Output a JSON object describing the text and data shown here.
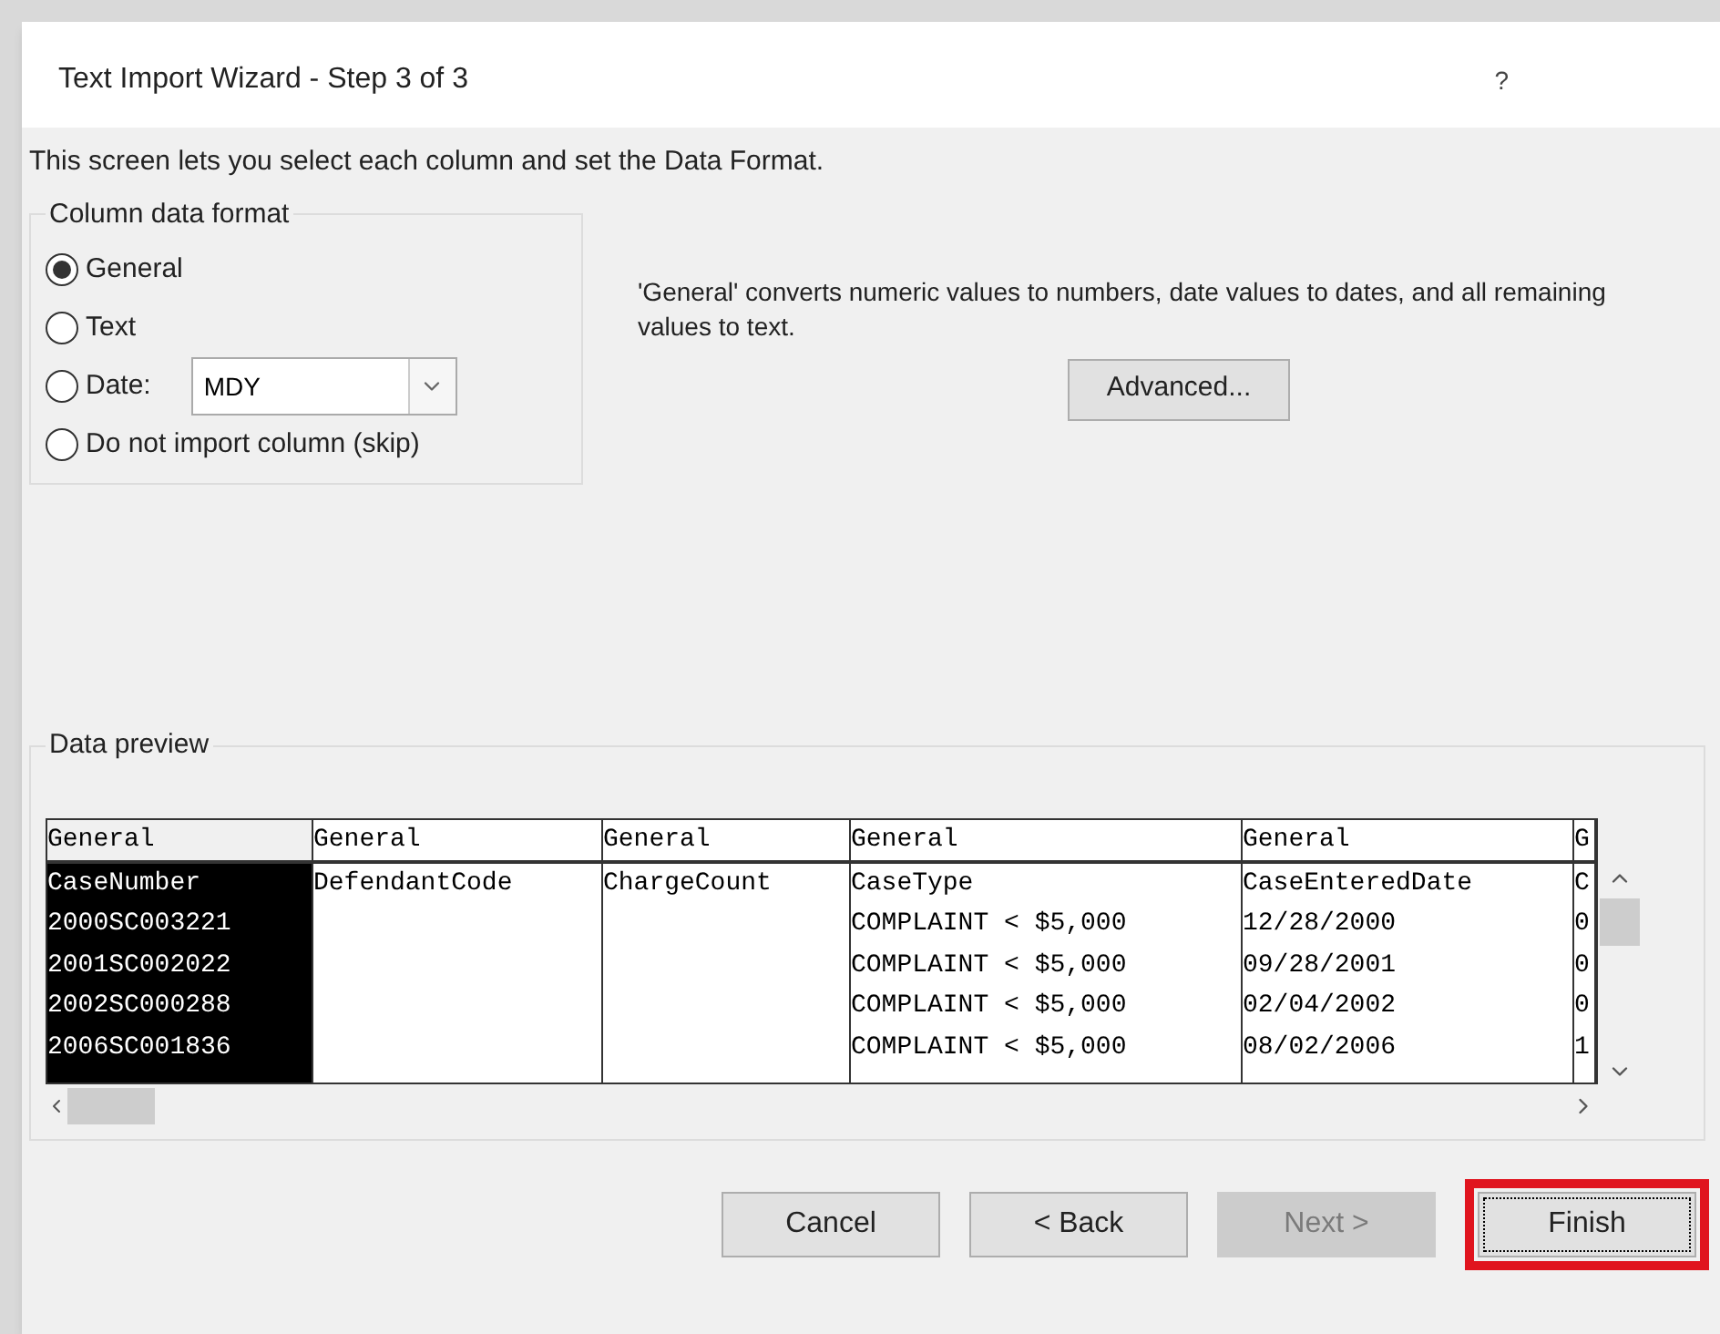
{
  "window": {
    "title": "Text Import Wizard - Step 3 of 3",
    "help": "?"
  },
  "intro": "This screen lets you select each column and set the Data Format.",
  "column_data_format": {
    "title": "Column data format",
    "options": [
      {
        "label": "General",
        "selected": true,
        "kind": "plain"
      },
      {
        "label": "Text",
        "selected": false,
        "kind": "plain"
      },
      {
        "label": "Date:",
        "selected": false,
        "kind": "dropdown",
        "value": "MDY"
      },
      {
        "label": "Do not import column (skip)",
        "selected": false,
        "kind": "plain"
      }
    ]
  },
  "description": "'General' converts numeric values to numbers, date values to dates, and all remaining values to text.",
  "advanced_button": "Advanced...",
  "data_preview": {
    "title": "Data preview",
    "columns": [
      {
        "format": "General",
        "selected": true,
        "cells": [
          "CaseNumber",
          "2000SC003221",
          "2001SC002022",
          "2002SC000288",
          "2006SC001836"
        ]
      },
      {
        "format": "General",
        "selected": false,
        "cells": [
          "DefendantCode",
          "",
          "",
          "",
          ""
        ]
      },
      {
        "format": "General",
        "selected": false,
        "cells": [
          "ChargeCount",
          "",
          "",
          "",
          ""
        ]
      },
      {
        "format": "General",
        "selected": false,
        "cells": [
          "CaseType",
          "COMPLAINT < $5,000",
          "COMPLAINT < $5,000",
          "COMPLAINT < $5,000",
          "COMPLAINT < $5,000"
        ]
      },
      {
        "format": "General",
        "selected": false,
        "cells": [
          "CaseEnteredDate",
          "12/28/2000",
          "09/28/2001",
          "02/04/2002",
          "08/02/2006"
        ]
      },
      {
        "format": "G",
        "selected": false,
        "cells": [
          "C",
          "0",
          "0",
          "0",
          "1"
        ]
      }
    ]
  },
  "buttons": [
    {
      "label": "Cancel",
      "disabled": false,
      "highlighted": false
    },
    {
      "label": "< Back",
      "disabled": false,
      "highlighted": false
    },
    {
      "label": "Next >",
      "disabled": true,
      "highlighted": false
    },
    {
      "label": "Finish",
      "disabled": false,
      "highlighted": true
    }
  ]
}
